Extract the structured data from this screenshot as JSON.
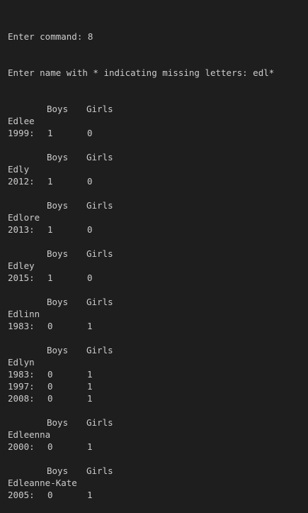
{
  "prompt_line": "Enter command: 8",
  "query_line": "Enter name with * indicating missing letters: edl*",
  "header": {
    "boys": "Boys",
    "girls": "Girls"
  },
  "results": [
    {
      "name": "Edlee",
      "rows": [
        {
          "year": "1999:",
          "boys": "1",
          "girls": "0"
        }
      ]
    },
    {
      "name": "Edly",
      "rows": [
        {
          "year": "2012:",
          "boys": "1",
          "girls": "0"
        }
      ]
    },
    {
      "name": "Edlore",
      "rows": [
        {
          "year": "2013:",
          "boys": "1",
          "girls": "0"
        }
      ]
    },
    {
      "name": "Edley",
      "rows": [
        {
          "year": "2015:",
          "boys": "1",
          "girls": "0"
        }
      ]
    },
    {
      "name": "Edlinn",
      "rows": [
        {
          "year": "1983:",
          "boys": "0",
          "girls": "1"
        }
      ]
    },
    {
      "name": "Edlyn",
      "rows": [
        {
          "year": "1983:",
          "boys": "0",
          "girls": "1"
        },
        {
          "year": "1997:",
          "boys": "0",
          "girls": "1"
        },
        {
          "year": "2008:",
          "boys": "0",
          "girls": "1"
        }
      ]
    },
    {
      "name": "Edleenna",
      "rows": [
        {
          "year": "2000:",
          "boys": "0",
          "girls": "1"
        }
      ]
    },
    {
      "name": "Edleanne-Kate",
      "rows": [
        {
          "year": "2005:",
          "boys": "0",
          "girls": "1"
        }
      ]
    }
  ]
}
